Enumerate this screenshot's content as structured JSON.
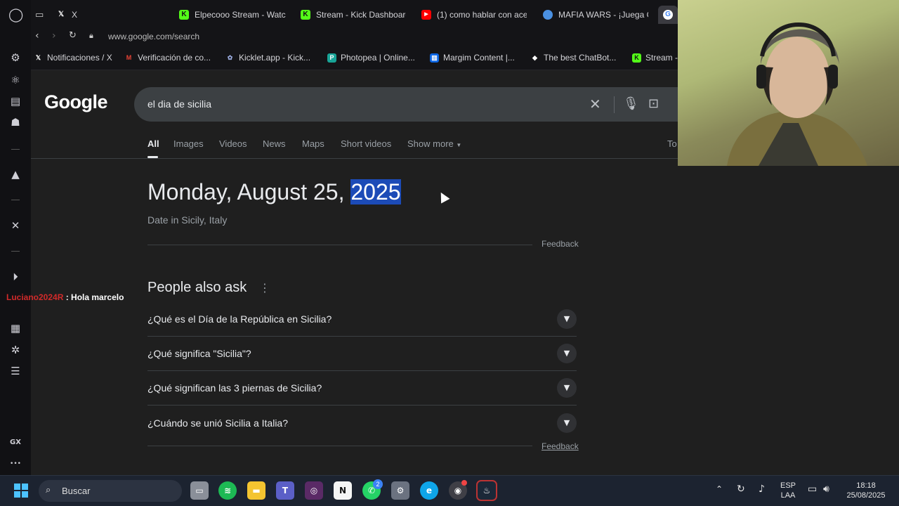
{
  "browser": {
    "tabs": [
      {
        "label": "X",
        "icon": "x-logo-icon"
      },
      {
        "label": "Elpecooo Stream - Watc",
        "icon": "kick-logo-icon",
        "color": "#53fc18"
      },
      {
        "label": "Stream - Kick Dashboard",
        "icon": "kick-logo-icon",
        "color": "#53fc18"
      },
      {
        "label": "(1) como hablar con ace",
        "icon": "youtube-icon",
        "color": "#ff0000"
      },
      {
        "label": "MAFIA WARS - ¡Juega G",
        "icon": "mafia-wars-icon",
        "color": "#4a90e2"
      },
      {
        "label": "",
        "icon": "google-icon"
      }
    ],
    "url": "www.google.com/search",
    "bookmarks": [
      {
        "label": "Notificaciones / X",
        "icon": "x-logo-icon"
      },
      {
        "label": "Verificación de co...",
        "icon": "gmail-icon"
      },
      {
        "label": "Kicklet.app - Kick...",
        "icon": "kicklet-icon"
      },
      {
        "label": "Photopea | Online...",
        "icon": "photopea-icon"
      },
      {
        "label": "Margim Content |...",
        "icon": "trello-icon"
      },
      {
        "label": "The best ChatBot...",
        "icon": "chatbot-icon"
      },
      {
        "label": "Stream -",
        "icon": "kick-logo-icon"
      }
    ]
  },
  "google": {
    "logo": "Google",
    "query": "el dia de sicilia",
    "nav": [
      "All",
      "Images",
      "Videos",
      "News",
      "Maps",
      "Short videos",
      "Show more"
    ],
    "nav_right": "To",
    "answer": {
      "date_prefix": "Monday, August 25, ",
      "date_year": "2025",
      "subtitle": "Date in Sicily, Italy",
      "feedback": "Feedback"
    },
    "paa": {
      "title": "People also ask",
      "questions": [
        "¿Qué es el Día de la República en Sicilia?",
        "¿Qué significa \"Sicilia\"?",
        "¿Qué significan las 3 piernas de Sicilia?",
        "¿Cuándo se unió Sicilia a Italia?"
      ],
      "feedback": "Feedback"
    }
  },
  "chat": {
    "user": "Luciano2024R",
    "message": " : Hola marcelo"
  },
  "sidebar": {
    "gx_label": "GX",
    "more_label": "•••"
  },
  "taskbar": {
    "search_placeholder": "Buscar",
    "whatsapp_badge": "2",
    "lang_top": "ESP",
    "lang_bottom": "LAA",
    "time": "18:18",
    "date": "25/08/2025"
  }
}
